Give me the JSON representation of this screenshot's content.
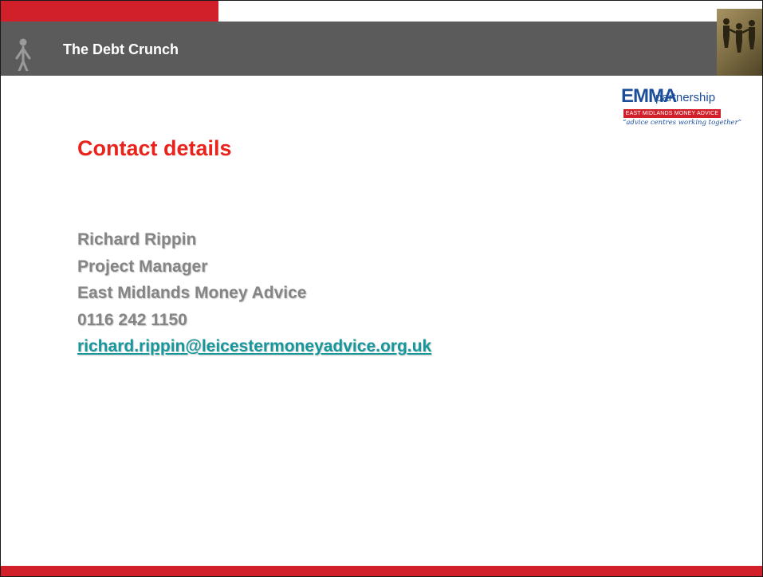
{
  "header": {
    "title": "The Debt Crunch"
  },
  "logo": {
    "name": "EMMA",
    "word": "partnership",
    "band": "EAST MIDLANDS MONEY ADVICE",
    "tagline": "“advice centres working together”"
  },
  "slide": {
    "title": "Contact details"
  },
  "contact": {
    "name": "Richard Rippin",
    "role": "Project Manager",
    "organisation": "East Midlands Money Advice",
    "phone": "0116 242 1150",
    "email": "richard.rippin@leicestermoneyadvice.org.uk"
  },
  "colors": {
    "accent_red": "#d2202b",
    "title_red": "#e8231c",
    "header_grey": "#5b5b5b",
    "body_grey": "#858585",
    "link_teal": "#15989c",
    "logo_blue": "#1d4e9a"
  }
}
